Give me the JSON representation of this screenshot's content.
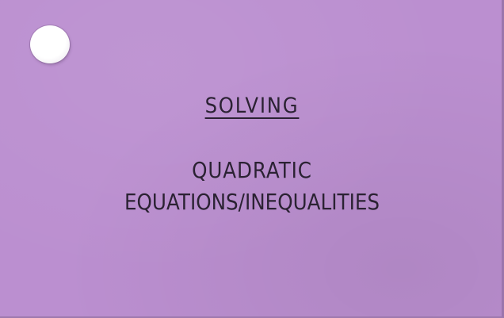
{
  "card": {
    "heading": "SOLVING",
    "title_line_1": "QUADRATIC",
    "title_line_2": "EQUATIONS/INEQUALITIES"
  }
}
